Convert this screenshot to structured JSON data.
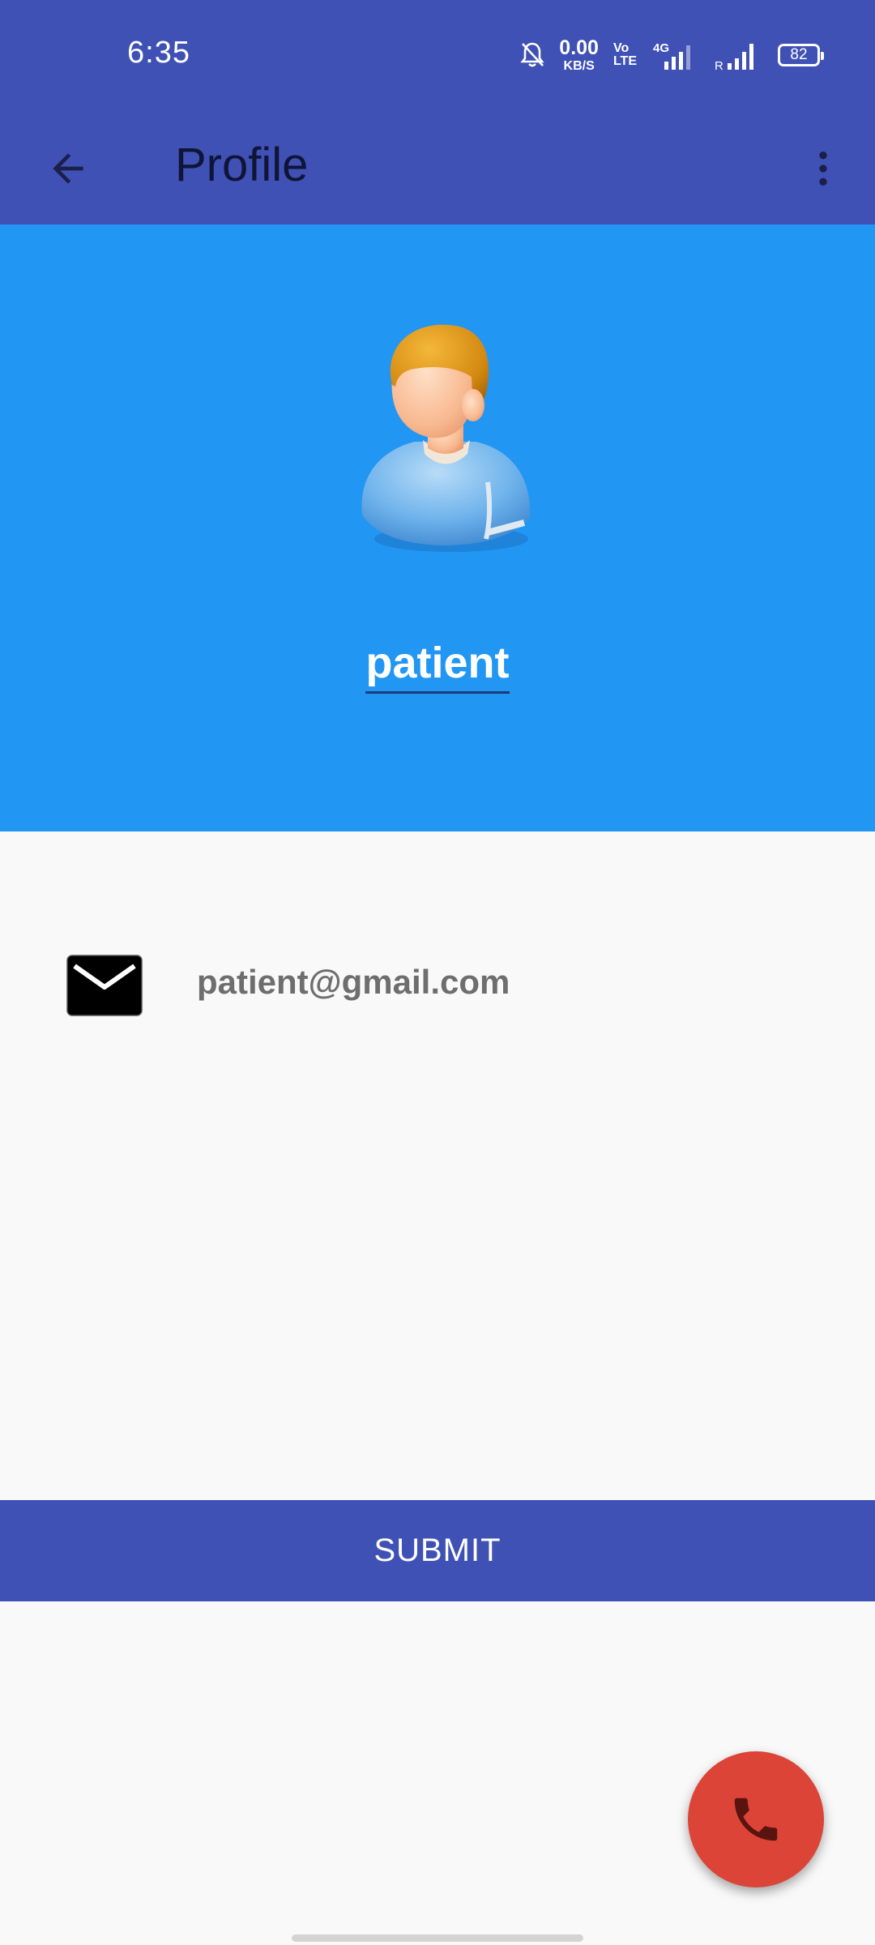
{
  "status_bar": {
    "time": "6:35",
    "net_speed_value": "0.00",
    "net_speed_unit": "KB/S",
    "volte_top": "Vo",
    "volte_bottom": "LTE",
    "network_type": "4G",
    "roaming_label": "R",
    "battery_level": "82",
    "icons": [
      "bell-muted-icon",
      "signal-4g-icon",
      "signal-bars-icon",
      "battery-icon"
    ]
  },
  "toolbar": {
    "title": "Profile",
    "back_icon": "arrow-back-icon",
    "overflow_icon": "more-vert-icon"
  },
  "profile": {
    "name": "patient",
    "avatar_icon": "user-avatar-icon",
    "email": "patient@gmail.com",
    "email_icon": "envelope-icon"
  },
  "actions": {
    "submit_label": "SUBMIT",
    "fab_icon": "phone-icon"
  },
  "colors": {
    "primary": "#3f51b5",
    "header_blue": "#2196f3",
    "fab_red": "#db4437",
    "background": "#f9f9f9",
    "email_text": "#6e6e6e"
  }
}
